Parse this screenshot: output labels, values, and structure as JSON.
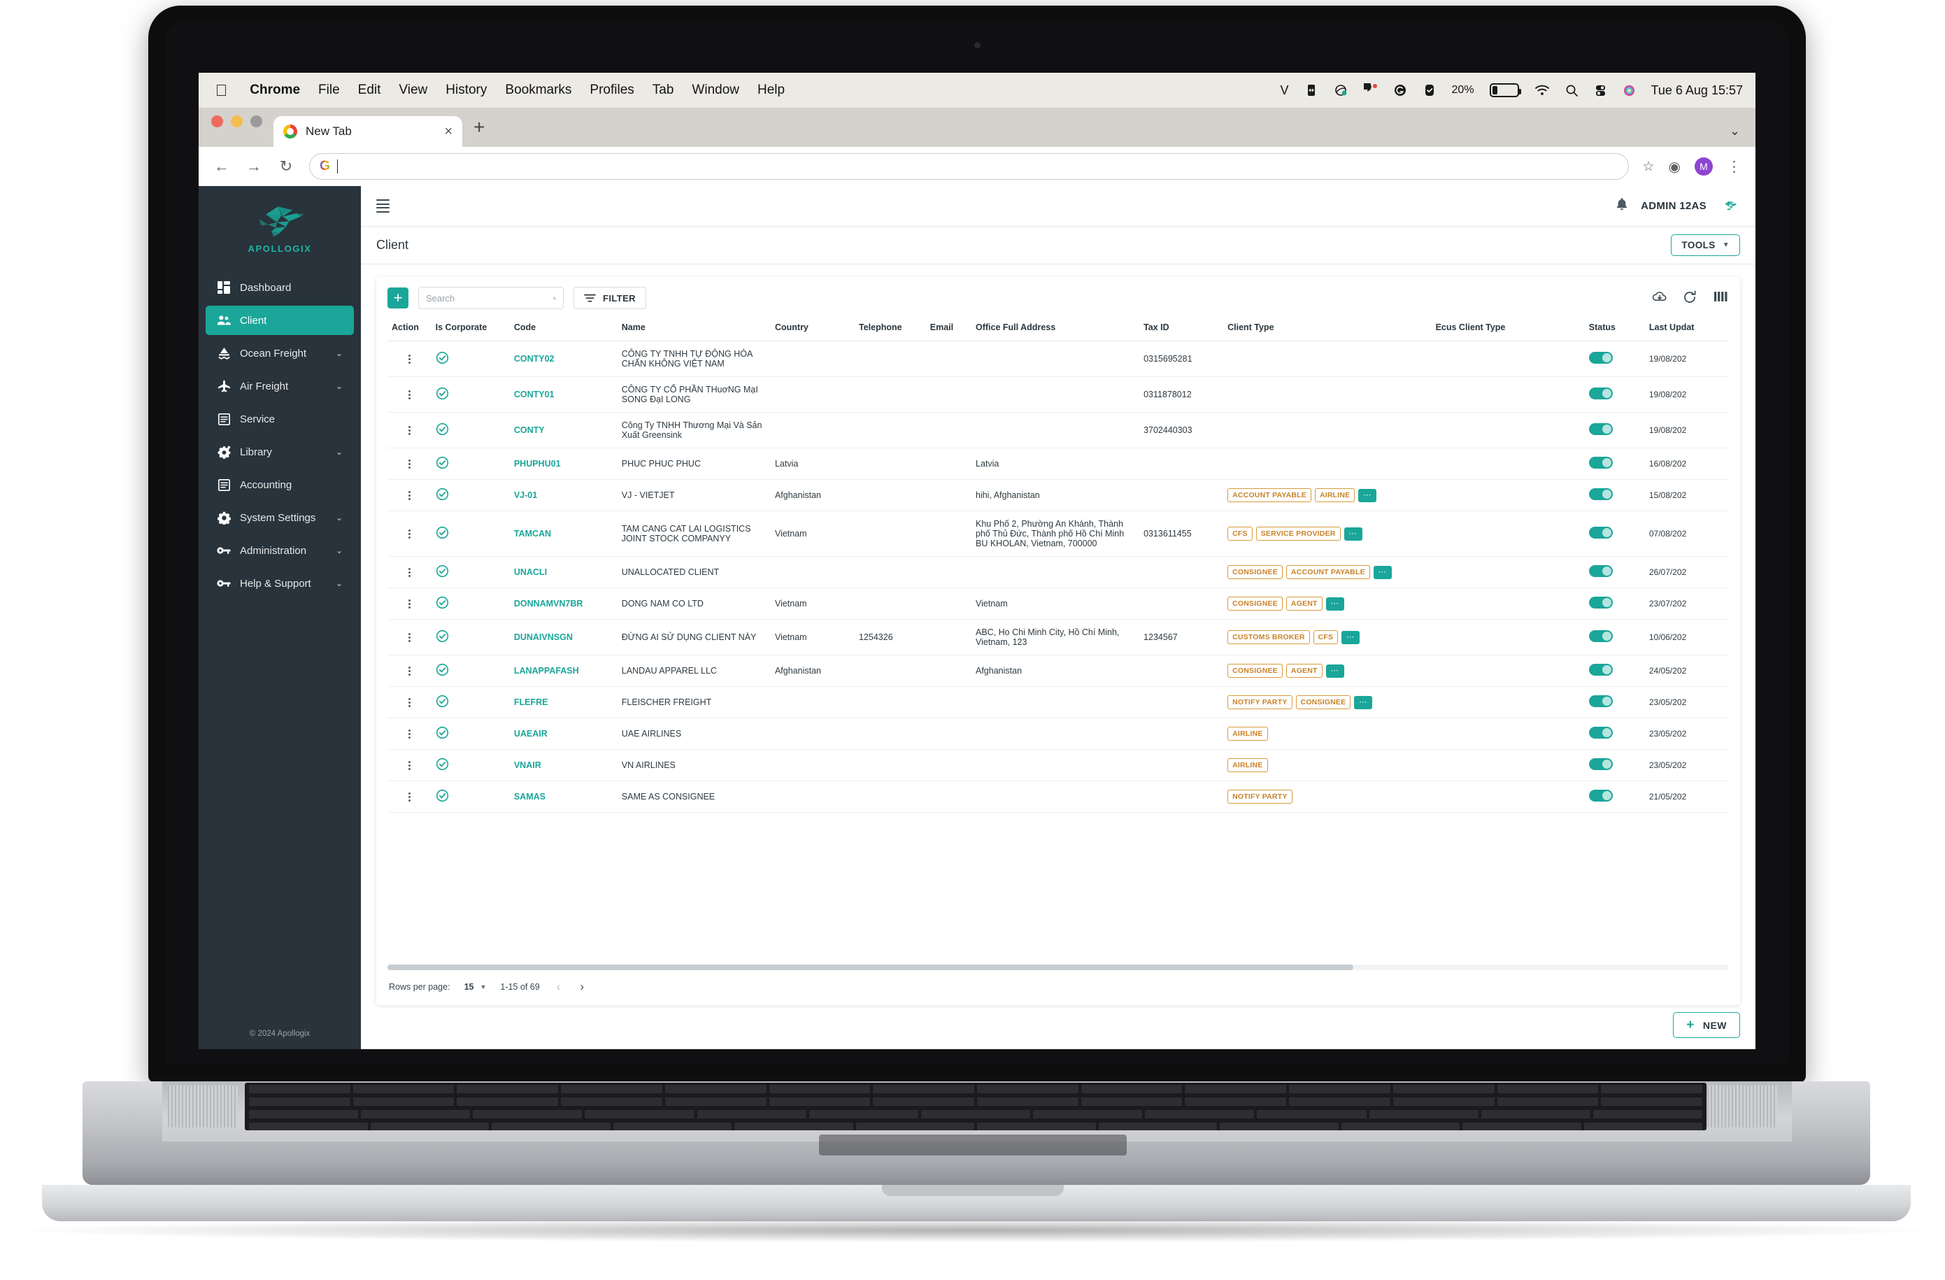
{
  "macos_menubar": {
    "apple_icon": "apple-icon",
    "items": [
      "Chrome",
      "File",
      "Edit",
      "View",
      "History",
      "Bookmarks",
      "Profiles",
      "Tab",
      "Window",
      "Help"
    ],
    "active_app": "Chrome",
    "status_icons": [
      "V",
      "screen-mirroring-icon",
      "cloud-sync-icon",
      "messenger-icon",
      "grammarly-icon",
      "checkmark-badge-icon"
    ],
    "battery_percent": "20%",
    "wifi_icon": "wifi-icon",
    "spotlight_icon": "search-icon",
    "control_center_icon": "control-center-icon",
    "siri_icon": "siri-icon",
    "clock": "Tue 6 Aug  15:57"
  },
  "browser": {
    "tab_title": "New Tab",
    "tab_close": "×",
    "new_tab": "+",
    "back": "←",
    "forward": "→",
    "reload": "↻",
    "url_value": "",
    "url_placeholder": "",
    "bookmark_star": "☆",
    "profile_initial": "M",
    "menu_dots": "⋮"
  },
  "sidebar": {
    "logo_text": "APOLLOGIX",
    "items": [
      {
        "label": "Dashboard",
        "icon": "dashboard-icon",
        "active": false,
        "expandable": false
      },
      {
        "label": "Client",
        "icon": "users-icon",
        "active": true,
        "expandable": false
      },
      {
        "label": "Ocean Freight",
        "icon": "ship-icon",
        "active": false,
        "expandable": true
      },
      {
        "label": "Air Freight",
        "icon": "plane-icon",
        "active": false,
        "expandable": true
      },
      {
        "label": "Service",
        "icon": "list-icon",
        "active": false,
        "expandable": false
      },
      {
        "label": "Library",
        "icon": "gear-sparkle-icon",
        "active": false,
        "expandable": true
      },
      {
        "label": "Accounting",
        "icon": "list-icon",
        "active": false,
        "expandable": false
      },
      {
        "label": "System Settings",
        "icon": "gear-icon",
        "active": false,
        "expandable": true
      },
      {
        "label": "Administration",
        "icon": "key-icon",
        "active": false,
        "expandable": true
      },
      {
        "label": "Help & Support",
        "icon": "key-icon",
        "active": false,
        "expandable": true
      }
    ],
    "footer": "© 2024 Apollogix"
  },
  "topbar": {
    "menu_icon": "hamburger-icon",
    "bell_icon": "bell-icon",
    "user_name": "ADMIN 12AS",
    "avatar": "bird-avatar"
  },
  "page": {
    "title": "Client",
    "tools_label": "TOOLS"
  },
  "toolbar": {
    "add_label": "+",
    "search_placeholder": "Search",
    "search_value": "",
    "filter_label": "FILTER",
    "download_icon": "cloud-download-icon",
    "refresh_icon": "refresh-icon",
    "columns_icon": "columns-icon"
  },
  "table": {
    "headers": [
      "Action",
      "Is Corporate",
      "Code",
      "Name",
      "Country",
      "Telephone",
      "Email",
      "Office Full Address",
      "Tax ID",
      "Client Type",
      "Ecus Client Type",
      "Status",
      "Last Updat"
    ],
    "rows": [
      {
        "code": "CONTY02",
        "name": "CÔNG TY TNHH TỰ ĐỘNG HÓA CHẤN KHÔNG VIỆT NAM",
        "country": "",
        "telephone": "",
        "email": "",
        "address": "",
        "tax_id": "0315695281",
        "client_types": [],
        "more": false,
        "ecus": "",
        "status": true,
        "updated": "19/08/202"
      },
      {
        "code": "CONTY01",
        "name": "CÔNG TY CỔ PHẦN THuơNG MạI SONG ĐạI LONG",
        "country": "",
        "telephone": "",
        "email": "",
        "address": "",
        "tax_id": "0311878012",
        "client_types": [],
        "more": false,
        "ecus": "",
        "status": true,
        "updated": "19/08/202"
      },
      {
        "code": "CONTY",
        "name": "Công Ty TNHH Thương Mại Và Sản Xuất Greensink",
        "country": "",
        "telephone": "",
        "email": "",
        "address": "",
        "tax_id": "3702440303",
        "client_types": [],
        "more": false,
        "ecus": "",
        "status": true,
        "updated": "19/08/202"
      },
      {
        "code": "PHUPHU01",
        "name": "PHUC PHUC PHUC",
        "country": "Latvia",
        "telephone": "",
        "email": "",
        "address": "Latvia",
        "tax_id": "",
        "client_types": [],
        "more": false,
        "ecus": "",
        "status": true,
        "updated": "16/08/202"
      },
      {
        "code": "VJ-01",
        "name": "VJ - VIETJET",
        "country": "Afghanistan",
        "telephone": "",
        "email": "",
        "address": "hihi, Afghanistan",
        "tax_id": "",
        "client_types": [
          "ACCOUNT PAYABLE",
          "AIRLINE"
        ],
        "more": true,
        "ecus": "",
        "status": true,
        "updated": "15/08/202"
      },
      {
        "code": "TAMCAN",
        "name": "TAM CANG CAT LAI LOGISTICS JOINT STOCK COMPANYY",
        "country": "Vietnam",
        "telephone": "",
        "email": "",
        "address": "Khu Phố 2, Phường An Khánh, Thành phố Thủ Đức, Thành phố Hồ Chí Minh BU KHOLAN, Vietnam, 700000",
        "tax_id": "0313611455",
        "client_types": [
          "CFS",
          "SERVICE PROVIDER"
        ],
        "more": true,
        "ecus": "",
        "status": true,
        "updated": "07/08/202"
      },
      {
        "code": "UNACLI",
        "name": "UNALLOCATED CLIENT",
        "country": "",
        "telephone": "",
        "email": "",
        "address": "",
        "tax_id": "",
        "client_types": [
          "CONSIGNEE",
          "ACCOUNT PAYABLE"
        ],
        "more": true,
        "ecus": "",
        "status": true,
        "updated": "26/07/202"
      },
      {
        "code": "DONNAMVN7BR",
        "name": "DONG NAM CO LTD",
        "country": "Vietnam",
        "telephone": "",
        "email": "",
        "address": "Vietnam",
        "tax_id": "",
        "client_types": [
          "CONSIGNEE",
          "AGENT"
        ],
        "more": true,
        "ecus": "",
        "status": true,
        "updated": "23/07/202"
      },
      {
        "code": "DUNAIVNSGN",
        "name": "ĐỪNG AI SỬ DỤNG CLIENT NÀY",
        "country": "Vietnam",
        "telephone": "1254326",
        "email": "",
        "address": "ABC, Ho Chi Minh City, Hồ Chí Minh, Vietnam, 123",
        "tax_id": "1234567",
        "client_types": [
          "CUSTOMS BROKER",
          "CFS"
        ],
        "more": true,
        "ecus": "",
        "status": true,
        "updated": "10/06/202"
      },
      {
        "code": "LANAPPAFASH",
        "name": "LANDAU APPAREL LLC",
        "country": "Afghanistan",
        "telephone": "",
        "email": "",
        "address": "Afghanistan",
        "tax_id": "",
        "client_types": [
          "CONSIGNEE",
          "AGENT"
        ],
        "more": true,
        "ecus": "",
        "status": true,
        "updated": "24/05/202"
      },
      {
        "code": "FLEFRE",
        "name": "FLEISCHER FREIGHT",
        "country": "",
        "telephone": "",
        "email": "",
        "address": "",
        "tax_id": "",
        "client_types": [
          "NOTIFY PARTY",
          "CONSIGNEE"
        ],
        "more": true,
        "ecus": "",
        "status": true,
        "updated": "23/05/202"
      },
      {
        "code": "UAEAIR",
        "name": "UAE AIRLINES",
        "country": "",
        "telephone": "",
        "email": "",
        "address": "",
        "tax_id": "",
        "client_types": [
          "AIRLINE"
        ],
        "more": false,
        "ecus": "",
        "status": true,
        "updated": "23/05/202"
      },
      {
        "code": "VNAIR",
        "name": "VN AIRLINES",
        "country": "",
        "telephone": "",
        "email": "",
        "address": "",
        "tax_id": "",
        "client_types": [
          "AIRLINE"
        ],
        "more": false,
        "ecus": "",
        "status": true,
        "updated": "23/05/202"
      },
      {
        "code": "SAMAS",
        "name": "SAME AS CONSIGNEE",
        "country": "",
        "telephone": "",
        "email": "",
        "address": "",
        "tax_id": "",
        "client_types": [
          "NOTIFY PARTY"
        ],
        "more": false,
        "ecus": "",
        "status": true,
        "updated": "21/05/202"
      }
    ]
  },
  "paging": {
    "rows_per_page_label": "Rows per page:",
    "rows_per_page_value": "15",
    "range": "1-15 of 69",
    "prev": "‹",
    "next": "›"
  },
  "footer": {
    "new_label": "NEW",
    "new_plus": "+"
  },
  "colors": {
    "accent": "#1aa699",
    "sidebar_bg": "#28333b",
    "badge": "#c8822b"
  }
}
